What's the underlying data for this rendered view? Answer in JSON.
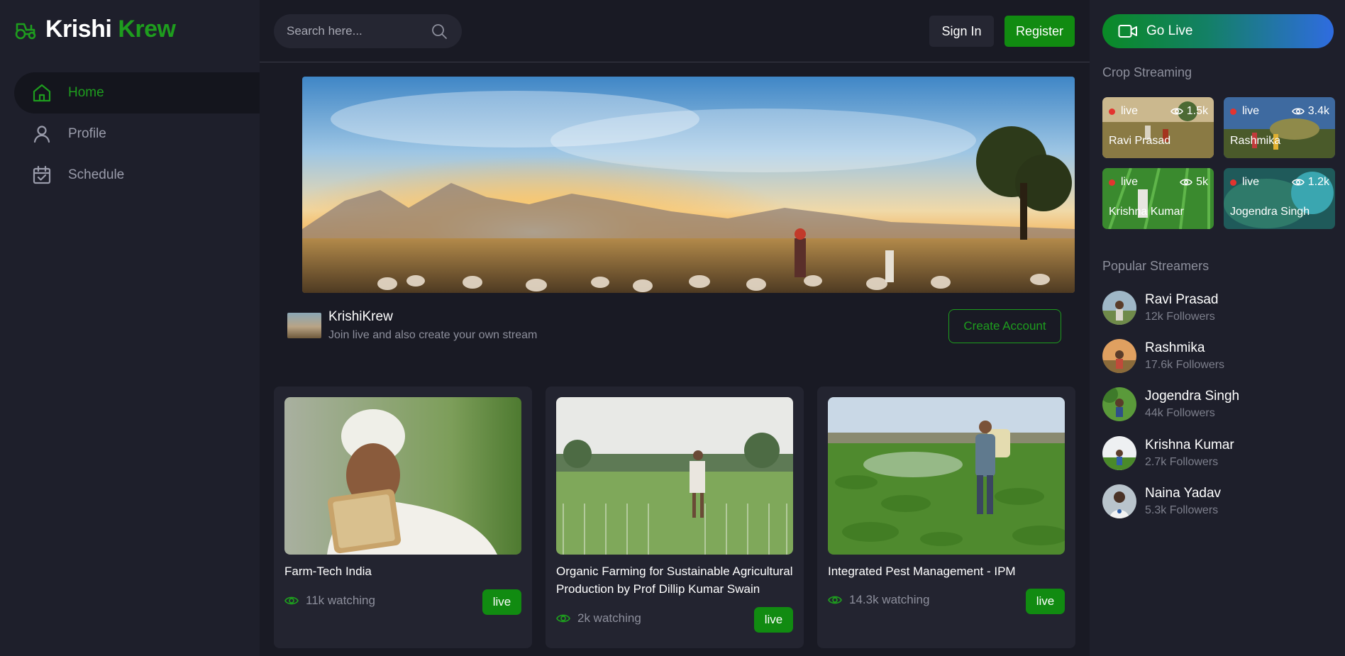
{
  "brand": {
    "word1": "Krishi",
    "word2": "Krew",
    "icon": "tractor-icon"
  },
  "nav": [
    {
      "label": "Home",
      "icon": "home-icon",
      "active": true
    },
    {
      "label": "Profile",
      "icon": "user-icon",
      "active": false
    },
    {
      "label": "Schedule",
      "icon": "calendar-icon",
      "active": false
    }
  ],
  "search": {
    "placeholder": "Search here..."
  },
  "auth": {
    "signin": "Sign In",
    "register": "Register"
  },
  "channel": {
    "name": "KrishiKrew",
    "tagline": "Join live and also create your own stream",
    "cta": "Create Account"
  },
  "cards": [
    {
      "title": "Farm-Tech India",
      "watching": "11k watching",
      "badge": "live"
    },
    {
      "title": "Organic Farming for Sustainable Agricultural Production by Prof Dillip Kumar Swain",
      "watching": "2k watching",
      "badge": "live"
    },
    {
      "title": "Integrated Pest Management - IPM",
      "watching": "14.3k watching",
      "badge": "live"
    }
  ],
  "right": {
    "golive": "Go Live",
    "crop_title": "Crop Streaming",
    "streams": [
      {
        "status": "live",
        "views": "1.5k",
        "name": "Ravi Prasad"
      },
      {
        "status": "live",
        "views": "3.4k",
        "name": "Rashmika"
      },
      {
        "status": "live",
        "views": "5k",
        "name": "Krishna Kumar"
      },
      {
        "status": "live",
        "views": "1.2k",
        "name": "Jogendra Singh"
      }
    ],
    "popular_title": "Popular Streamers",
    "streamers": [
      {
        "name": "Ravi Prasad",
        "followers": "12k Followers"
      },
      {
        "name": "Rashmika",
        "followers": "17.6k Followers"
      },
      {
        "name": "Jogendra Singh",
        "followers": "44k Followers"
      },
      {
        "name": "Krishna Kumar",
        "followers": "2.7k Followers"
      },
      {
        "name": "Naina Yadav",
        "followers": "5.3k Followers"
      }
    ]
  },
  "colors": {
    "accent": "#1e9d1e",
    "button_green": "#118b11",
    "background": "#191a24",
    "panel": "#1e1f2b",
    "live_dot": "#e3342f"
  }
}
